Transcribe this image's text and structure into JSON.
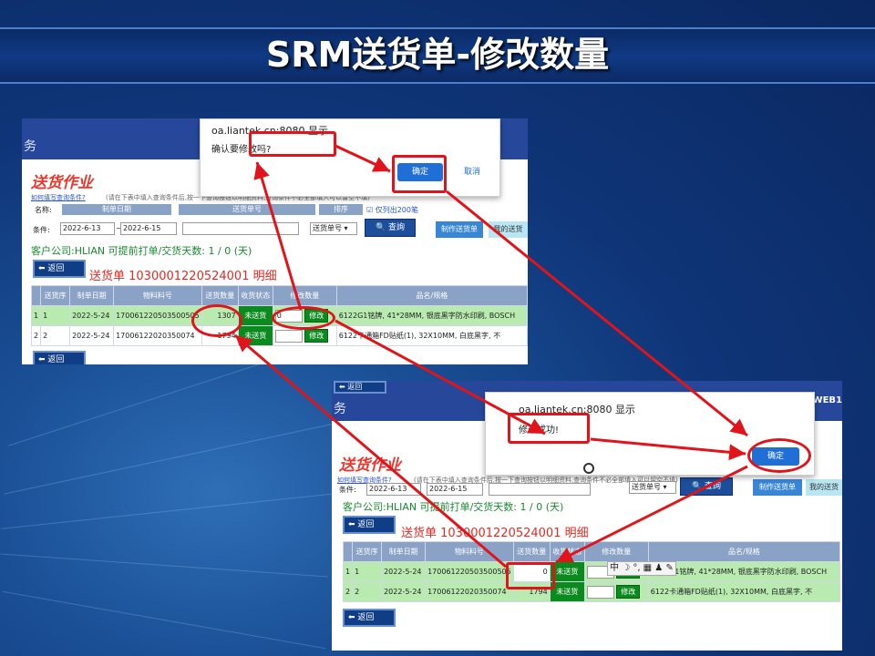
{
  "slide": {
    "title": "SRM送货单-修改数量"
  },
  "shot1": {
    "header_chrome": "务",
    "section_title": "送货作业",
    "help_link": "如何填写查询条件?",
    "hint": "(请在下表中填入查询条件后,按一下查询按钮以明细资料,查询条件不必全部填入可以留空不填)",
    "name_label": "名称:",
    "col_date": "制单日期",
    "col_ship_no": "送货单号",
    "col_sort": "排序",
    "only200": "仅列出200笔",
    "cond_label": "条件:",
    "date_from": "2022-6-13",
    "date_sep": "~",
    "date_to": "2022-6-15",
    "sort_select": "送货单号",
    "query_button": "查詢",
    "make_button": "制作送货单",
    "mine_button": "我的送货",
    "client_line": "客户公司:HLIAN   可提前打单/交货天数: 1 / 0 (天)",
    "back_button": "返回",
    "order_title": "送货单 1030001220524001 明细",
    "table": {
      "headers": [
        "",
        "送货序",
        "制单日期",
        "物料料号",
        "送货数量",
        "收货状态",
        "修改数量",
        "品名/规格"
      ],
      "rows": [
        {
          "idx": "1",
          "seq": "1",
          "date": "2022-5-24",
          "part": "170061220503500505",
          "qty": "1307",
          "status": "未送货",
          "edit_value": "0",
          "edit_button": "修改",
          "spec": "6122G1铭牌, 41*28MM, 银底黑字防水印刷, BOSCH"
        },
        {
          "idx": "2",
          "seq": "2",
          "date": "2022-5-24",
          "part": "17006122020350074",
          "qty": "1794",
          "status": "未送货",
          "edit_value": "",
          "edit_button": "修改",
          "spec": "6122卡通箱FD贴纸(1), 32X10MM, 白底黑字, 不"
        }
      ]
    },
    "dialog": {
      "origin": "oa.liantek.cn:8080 显示",
      "message": "确认要修改吗?",
      "ok": "确定",
      "cancel": "取消"
    }
  },
  "shot2": {
    "header_chrome": "务",
    "web_tag": "WEB1",
    "section_title": "送货作业",
    "help_link": "如何填写查询条件?",
    "hint": "(请在下表中填入查询条件后,按一下查询按钮以明细资料,查询条件不必全部填入可以留空不填)",
    "cond_label": "条件:",
    "date_from": "2022-6-13",
    "date_to": "2022-6-15",
    "sort_select": "送货单号",
    "query_button": "查詢",
    "make_button": "制作送货单",
    "mine_button": "我的送货",
    "client_line": "客户公司:HLIAN   可提前打单/交货天数: 1 / 0 (天)",
    "back_button": "返回",
    "order_title": "送货单 1030001220524001 明细",
    "table": {
      "headers": [
        "",
        "送货序",
        "制单日期",
        "物料料号",
        "送货数量",
        "收货状态",
        "修改数量",
        "品名/规格"
      ],
      "rows": [
        {
          "idx": "1",
          "seq": "1",
          "date": "2022-5-24",
          "part": "170061220503500505",
          "qty": "0",
          "status": "未送货",
          "edit_value": "",
          "edit_button": "修改",
          "spec": "6122G1铭牌, 41*28MM, 银底黑字防水印刷, BOSCH"
        },
        {
          "idx": "2",
          "seq": "2",
          "date": "2022-5-24",
          "part": "17006122020350074",
          "qty": "1794",
          "status": "未送货",
          "edit_value": "",
          "edit_button": "修改",
          "spec": "6122卡通箱FD贴纸(1), 32X10MM, 白底黑字, 不"
        }
      ]
    },
    "dialog": {
      "origin": "oa.liantek.cn:8080 显示",
      "message": "修改成功!",
      "ok": "确定"
    },
    "ime_bar": "中 ☽ °, ▦ ♟ ✎"
  },
  "colors": {
    "annotation_red": "#e0141a",
    "status_green": "#0b8a1e",
    "header_blue": "#27489a"
  }
}
